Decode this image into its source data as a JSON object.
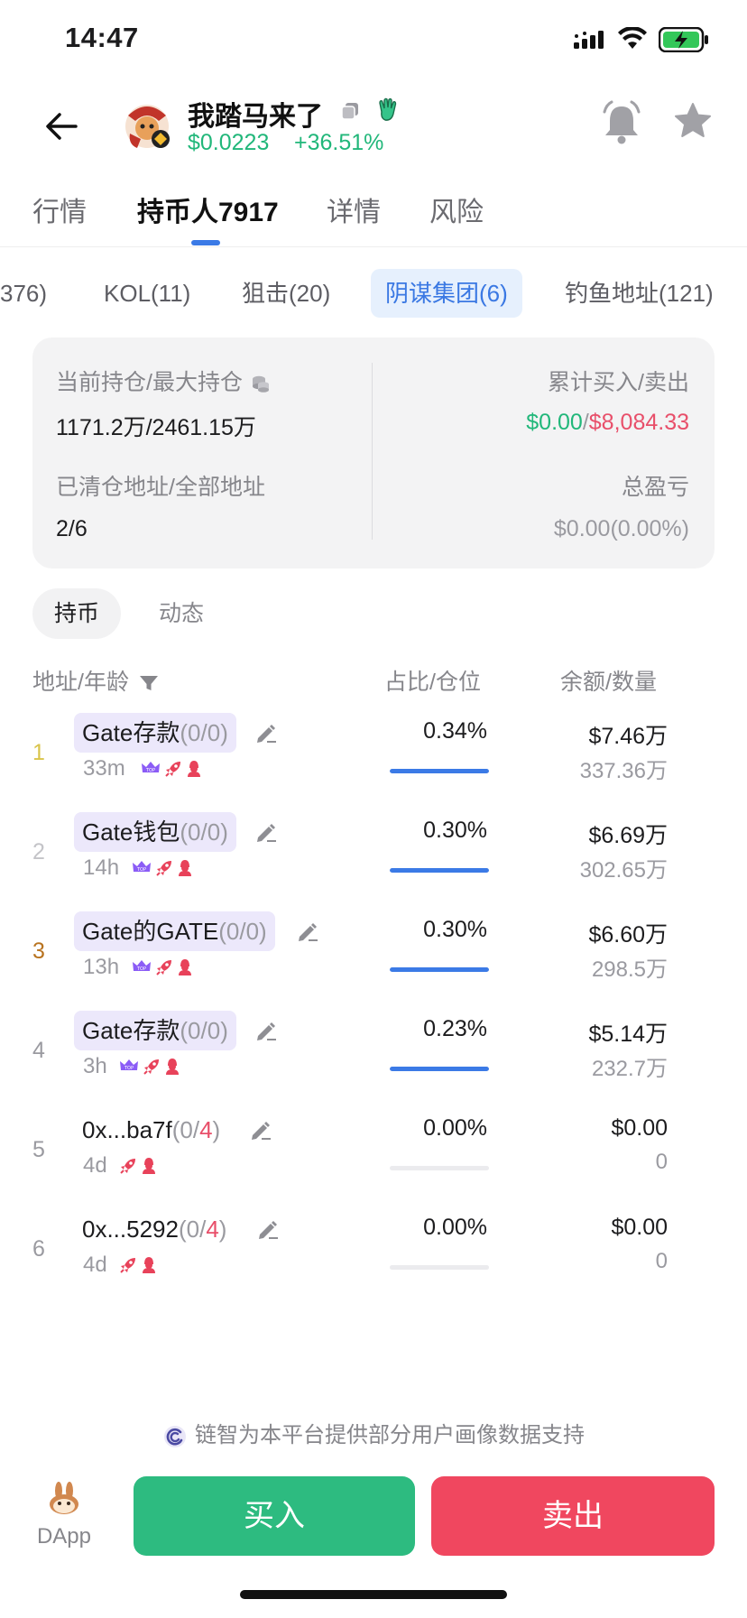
{
  "status_bar": {
    "time": "14:47"
  },
  "header": {
    "token_name": "我踏马来了",
    "price": "$0.0223",
    "change": "+36.51%"
  },
  "main_tabs": [
    {
      "label": "行情"
    },
    {
      "label": "持币人7917"
    },
    {
      "label": "详情"
    },
    {
      "label": "风险"
    }
  ],
  "sub_tabs": [
    {
      "label": "376)"
    },
    {
      "label": "KOL(11)"
    },
    {
      "label": "狙击(20)"
    },
    {
      "label": "阴谋集团(6)"
    },
    {
      "label": "钓鱼地址(121)"
    }
  ],
  "summary": {
    "holding_label": "当前持仓/最大持仓",
    "holding_value": "1171.2万/2461.15万",
    "cleared_label": "已清仓地址/全部地址",
    "cleared_value": "2/6",
    "trade_label": "累计买入/卖出",
    "bought": "$0.00",
    "slash": "/",
    "sold": "$8,084.33",
    "pnl_label": "总盈亏",
    "pnl_value": "$0.00(0.00%)"
  },
  "segments": [
    {
      "label": "持币"
    },
    {
      "label": "动态"
    }
  ],
  "list_header": {
    "address": "地址/年龄",
    "share": "占比/仓位",
    "balance": "余额/数量"
  },
  "holders": [
    {
      "rank": "1",
      "name": "Gate存款",
      "ratio": "(0/0)",
      "ratio_pre": "(0/",
      "ratio_num": "0",
      "ratio_post": ")",
      "age": "33m",
      "share": "0.34%",
      "share_fill": 1.0,
      "balance": "$7.46万",
      "qty": "337.36万",
      "rank_color": "#d9c44a",
      "tagged": true
    },
    {
      "rank": "2",
      "name": "Gate钱包",
      "ratio": "(0/0)",
      "ratio_pre": "(0/",
      "ratio_num": "0",
      "ratio_post": ")",
      "age": "14h",
      "share": "0.30%",
      "share_fill": 1.0,
      "balance": "$6.69万",
      "qty": "302.65万",
      "rank_color": "#c4c4c8",
      "tagged": true
    },
    {
      "rank": "3",
      "name": "Gate的GATE",
      "ratio": "(0/0)",
      "ratio_pre": "(0/",
      "ratio_num": "0",
      "ratio_post": ")",
      "age": "13h",
      "share": "0.30%",
      "share_fill": 1.0,
      "balance": "$6.60万",
      "qty": "298.5万",
      "rank_color": "#b8731f",
      "tagged": true
    },
    {
      "rank": "4",
      "name": "Gate存款",
      "ratio": "(0/0)",
      "ratio_pre": "(0/",
      "ratio_num": "0",
      "ratio_post": ")",
      "age": "3h",
      "share": "0.23%",
      "share_fill": 1.0,
      "balance": "$5.14万",
      "qty": "232.7万",
      "rank_color": "#9a9aa0",
      "tagged": true
    },
    {
      "rank": "5",
      "name": "0x...ba7f",
      "ratio": "(0/4)",
      "ratio_pre": "(0/",
      "ratio_num": "4",
      "ratio_post": ")",
      "age": "4d",
      "share": "0.00%",
      "share_fill": 0.0,
      "balance": "$0.00",
      "qty": "0",
      "rank_color": "#9a9aa0",
      "tagged": false
    },
    {
      "rank": "6",
      "name": "0x...5292",
      "ratio": "(0/4)",
      "ratio_pre": "(0/",
      "ratio_num": "4",
      "ratio_post": ")",
      "age": "4d",
      "share": "0.00%",
      "share_fill": 0.0,
      "balance": "$0.00",
      "qty": "0",
      "rank_color": "#9a9aa0",
      "tagged": false
    }
  ],
  "footer": {
    "data_note": "链智为本平台提供部分用户画像数据支持",
    "dapp": "DApp",
    "buy": "买入",
    "sell": "卖出"
  },
  "colors": {
    "positive": "#21b77a",
    "negative": "#e84f6a",
    "accent": "#3b7ae6",
    "buy": "#2dbb80",
    "sell": "#f0475f"
  }
}
